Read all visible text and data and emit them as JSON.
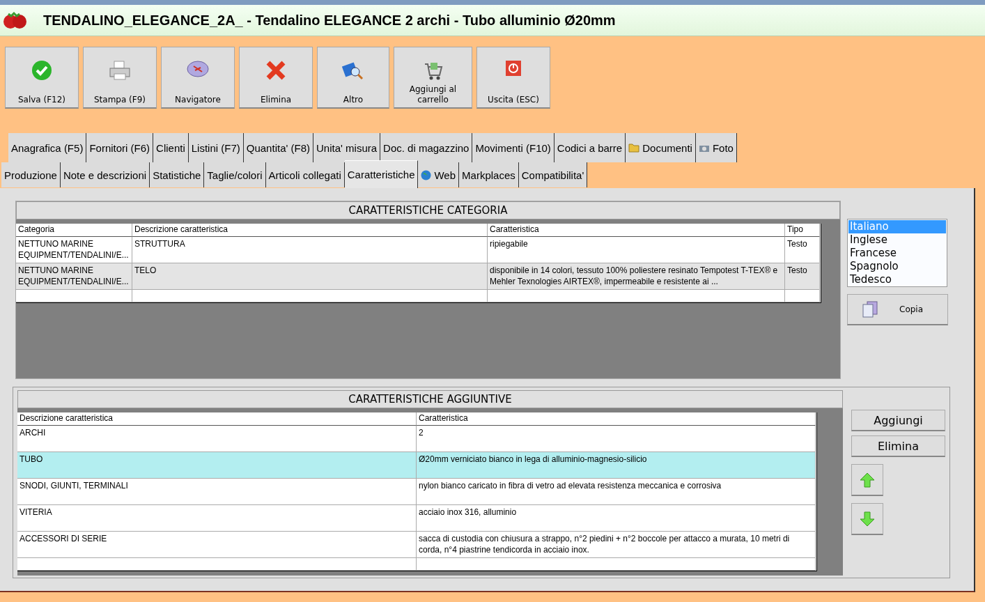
{
  "window": {
    "title": "TENDALINO_ELEGANCE_2A_ - Tendalino ELEGANCE 2 archi - Tubo alluminio Ø20mm"
  },
  "toolbar": [
    {
      "label": "Salva (F12)",
      "kind": "check"
    },
    {
      "label": "Stampa (F9)",
      "kind": "printer"
    },
    {
      "label": "Navigatore",
      "kind": "compass"
    },
    {
      "label": "Elimina",
      "kind": "cross"
    },
    {
      "label": "Altro",
      "kind": "magnifier"
    },
    {
      "label": "Aggiungi al carrello",
      "kind": "cart"
    },
    {
      "label": "Uscita (ESC)",
      "kind": "power"
    }
  ],
  "tabs_row_1": [
    {
      "label": "Anagrafica (F5)",
      "selected": false
    },
    {
      "label": "Fornitori (F6)",
      "selected": false
    },
    {
      "label": "Clienti",
      "selected": false
    },
    {
      "label": "Listini (F7)",
      "selected": false
    },
    {
      "label": "Quantita' (F8)",
      "selected": false
    },
    {
      "label": "Unita' misura",
      "selected": false
    },
    {
      "label": "Doc. di magazzino",
      "selected": false
    },
    {
      "label": "Movimenti (F10)",
      "selected": false
    },
    {
      "label": "Codici a barre",
      "selected": false
    },
    {
      "label": "Documenti",
      "selected": false,
      "kind": "folder"
    },
    {
      "label": "Foto",
      "selected": false,
      "kind": "camera"
    }
  ],
  "tabs_row_2": [
    {
      "label": "Produzione",
      "selected": false
    },
    {
      "label": "Note e descrizioni",
      "selected": false
    },
    {
      "label": "Statistiche",
      "selected": false
    },
    {
      "label": "Taglie/colori",
      "selected": false
    },
    {
      "label": "Articoli collegati",
      "selected": false
    },
    {
      "label": "Caratteristiche",
      "selected": true
    },
    {
      "label": "Web",
      "selected": false,
      "kind": "globe"
    },
    {
      "label": "Markplaces",
      "selected": false
    },
    {
      "label": "Compatibilita'",
      "selected": false
    }
  ],
  "category_table": {
    "title": "CARATTERISTICHE CATEGORIA",
    "columns": [
      "Categoria",
      "Descrizione caratteristica",
      "Caratteristica",
      "Tipo"
    ],
    "rows": [
      [
        "NETTUNO MARINE EQUIPMENT/TENDALINI/E...",
        "STRUTTURA",
        "ripiegabile",
        "Testo"
      ],
      [
        "NETTUNO MARINE EQUIPMENT/TENDALINI/E...",
        "TELO",
        "disponibile in 14 colori, tessuto 100% poliestere resinato Tempotest T-TEX® e Mehler Texnologies AIRTEX®, impermeabile e resistente ai ...",
        "Testo"
      ]
    ]
  },
  "languages": [
    {
      "label": "Italiano",
      "selected": true
    },
    {
      "label": "Inglese",
      "selected": false
    },
    {
      "label": "Francese",
      "selected": false
    },
    {
      "label": "Spagnolo",
      "selected": false
    },
    {
      "label": "Tedesco",
      "selected": false
    }
  ],
  "copy_button": "Copia",
  "extra_table": {
    "title": "CARATTERISTICHE AGGIUNTIVE",
    "columns": [
      "Descrizione caratteristica",
      "Caratteristica"
    ],
    "rows": [
      {
        "cells": [
          "ARCHI",
          "2"
        ],
        "selected": false
      },
      {
        "cells": [
          "TUBO",
          "Ø20mm verniciato bianco in lega di alluminio-magnesio-silicio"
        ],
        "selected": true
      },
      {
        "cells": [
          "SNODI, GIUNTI, TERMINALI",
          "nylon bianco caricato in fibra di vetro ad elevata resistenza meccanica e corrosiva"
        ],
        "selected": false
      },
      {
        "cells": [
          "VITERIA",
          "acciaio inox 316, alluminio"
        ],
        "selected": false
      },
      {
        "cells": [
          "ACCESSORI DI SERIE",
          "sacca di custodia con chiusura a strappo, n°2 piedini + n°2 boccole per attacco a murata, 10 metri di corda, n°4 piastrine tendicorda in acciaio inox."
        ],
        "selected": false
      }
    ]
  },
  "side_buttons": [
    "Aggiungi",
    "Elimina"
  ]
}
